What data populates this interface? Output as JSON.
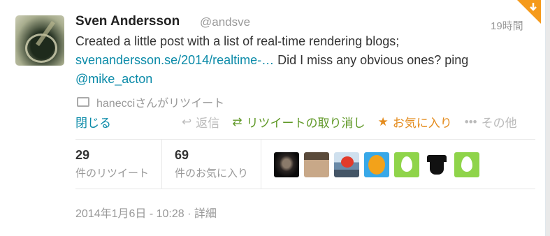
{
  "tweet": {
    "name": "Sven Andersson",
    "handle": "@andsve",
    "time": "19時間",
    "text_before": "Created a little post with a list of real-time rendering blogs; ",
    "link": "svenandersson.se/2014/realtime-…",
    "text_after": " Did I miss any obvious ones? ping ",
    "mention": "@mike_acton",
    "retweeted_by": "hanecciさんがリツイート",
    "close": "閉じる",
    "actions": {
      "reply": "返信",
      "retweet": "リツイートの取り消し",
      "favorite": "お気に入り",
      "more": "その他"
    },
    "stats": {
      "retweets": "29",
      "retweets_label": "件のリツイート",
      "favorites": "69",
      "favorites_label": "件のお気に入り"
    },
    "date": "2014年1月6日 - 10:28",
    "details": "詳細"
  },
  "colors": {
    "link": "#0a8aa8",
    "retweet_active": "#609928",
    "favorite": "#e48c1e",
    "corner": "#f59a1b"
  }
}
